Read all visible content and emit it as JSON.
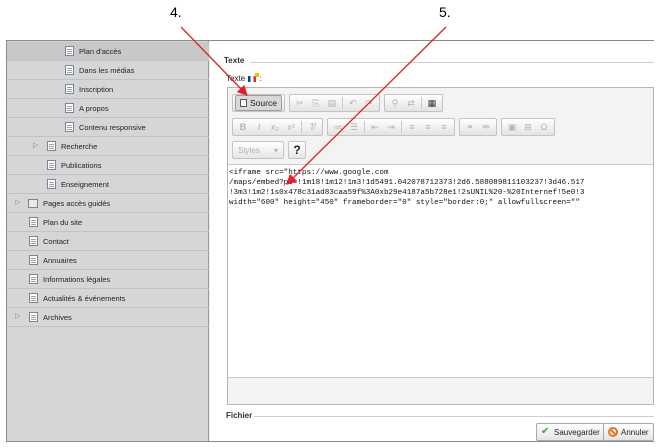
{
  "annotations": {
    "step4": "4.",
    "step5": "5."
  },
  "sidebar": {
    "items": [
      {
        "label": "Plan d'accès",
        "selected": true
      },
      {
        "label": "Dans les médias"
      },
      {
        "label": "Inscription"
      },
      {
        "label": "A propos"
      },
      {
        "label": "Contenu responsive"
      },
      {
        "label": "Recherche",
        "expandable": true
      },
      {
        "label": "Publications"
      },
      {
        "label": "Enseignement"
      },
      {
        "label": "Pages accès guidés",
        "expandable": true,
        "folder": true
      },
      {
        "label": "Plan du site"
      },
      {
        "label": "Contact"
      },
      {
        "label": "Annuaires"
      },
      {
        "label": "Informations légales"
      },
      {
        "label": "Actualités & événements"
      },
      {
        "label": "Archives",
        "expandable": true
      }
    ]
  },
  "content": {
    "section_title": "Texte",
    "field_label": "Texte",
    "field_suffix": ":",
    "fichier_title": "Fichier"
  },
  "editor": {
    "source_label": "Source",
    "styles_placeholder": "Styles",
    "help_label": "?",
    "source_lines": [
      "<iframe src=\"https://www.google.com",
      "/maps/embed?pb=!1m18!1m12!1m3!1d5491.042078712373!2d6.588089811103237!3d46.517",
      "!3m3!1m2!1s0x478c31ad83caa59f%3A0xb29e4187a5b728e1!2sUNIL%20-%20Internef!5e0!3",
      "width=\"600\" height=\"450\" frameborder=\"0\" style=\"border:0;\" allowfullscreen=\"\" "
    ]
  },
  "actions": {
    "save_label": "Sauvegarder",
    "cancel_label": "Annuler"
  },
  "colors": {
    "sidebar_bg": "#d6d6d6",
    "arrow": "#e0202a",
    "save_icon": "#3aa33a",
    "cancel_icon": "#e0782a"
  }
}
